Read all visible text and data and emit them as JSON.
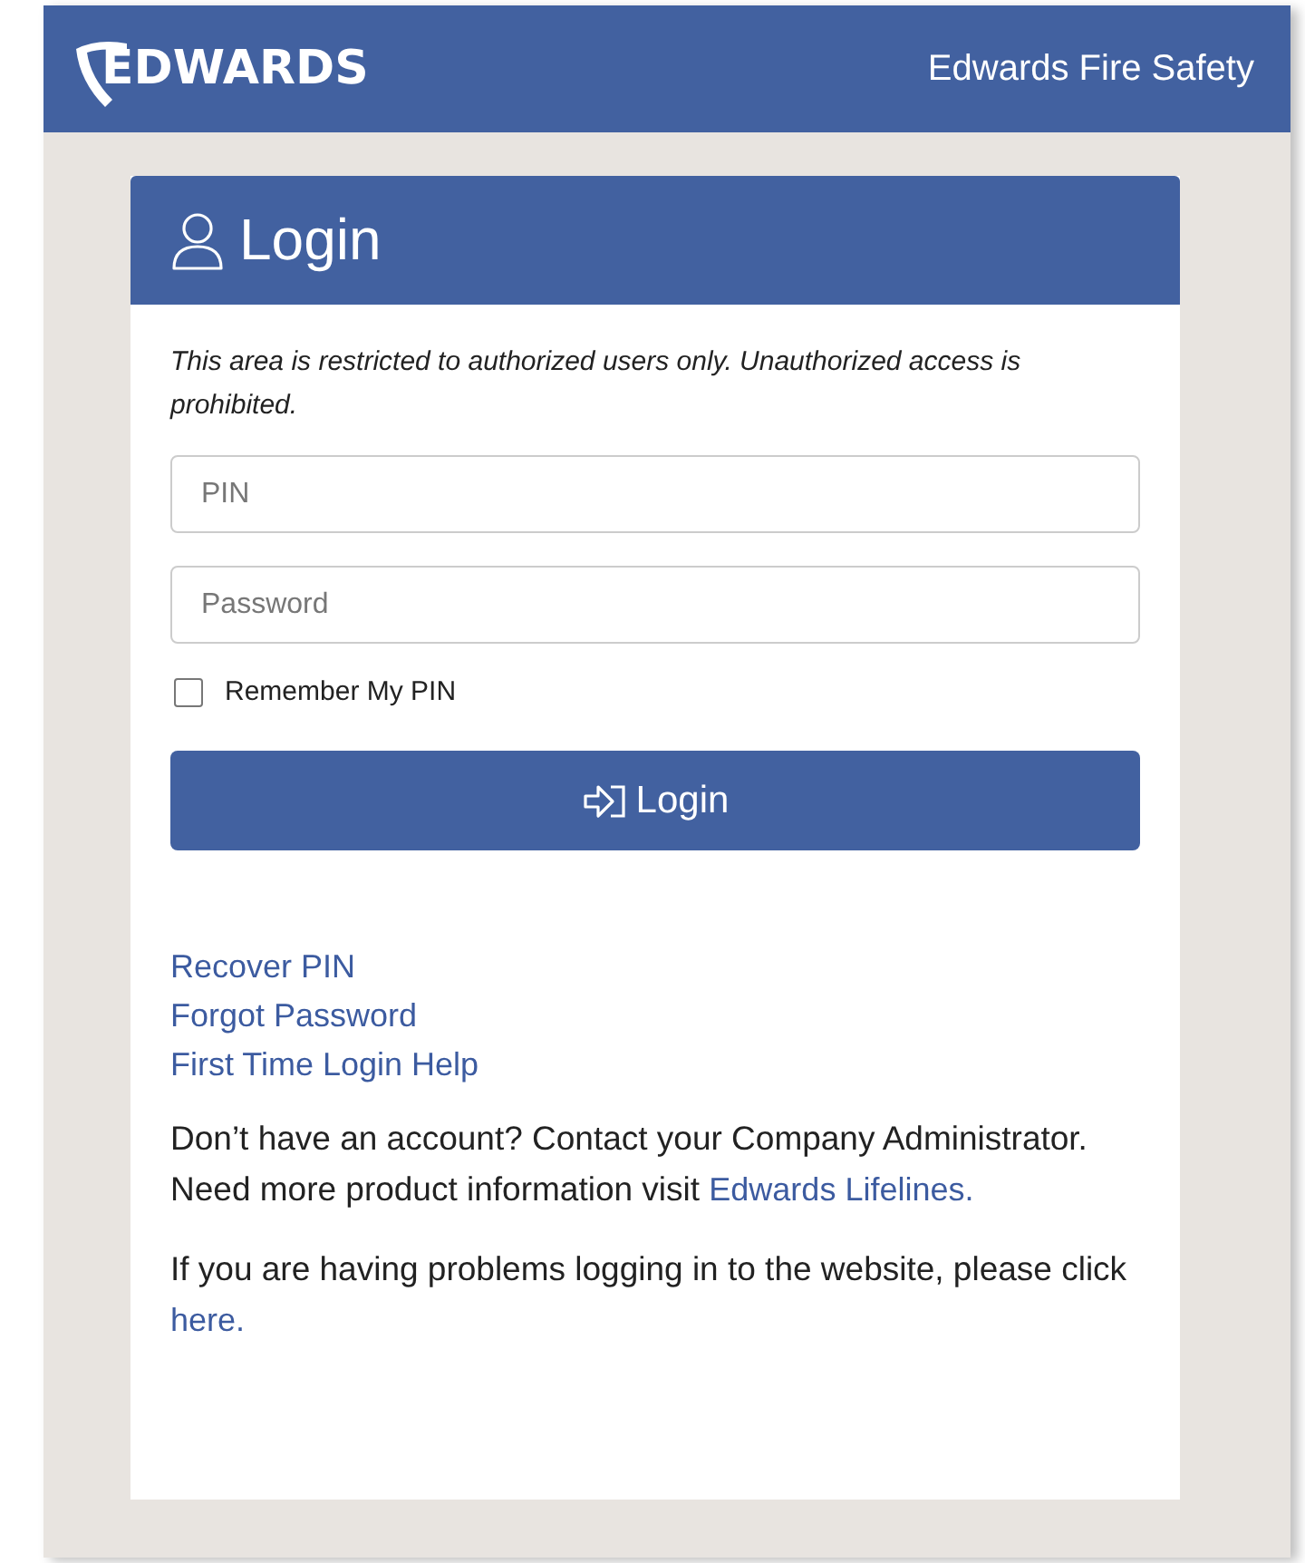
{
  "header": {
    "logo": "EDWARDS",
    "title": "Edwards Fire Safety"
  },
  "card": {
    "title": "Login",
    "notice": "This area is restricted to authorized users only. Unauthorized access is prohibited.",
    "fields": [
      {
        "placeholder": "PIN"
      },
      {
        "placeholder": "Password"
      }
    ],
    "remember": {
      "label": "Remember My PIN",
      "checked": false
    },
    "submit": "Login",
    "links": [
      "Recover PIN",
      "Forgot Password",
      "First Time Login Help"
    ],
    "paragraphs": [
      {
        "before": "Don’t have an account? Contact your Company Administrator. Need more product information visit ",
        "link": "Edwards Lifelines."
      },
      {
        "before": "If you are having problems logging in to the website, please click ",
        "link": "here."
      }
    ]
  }
}
